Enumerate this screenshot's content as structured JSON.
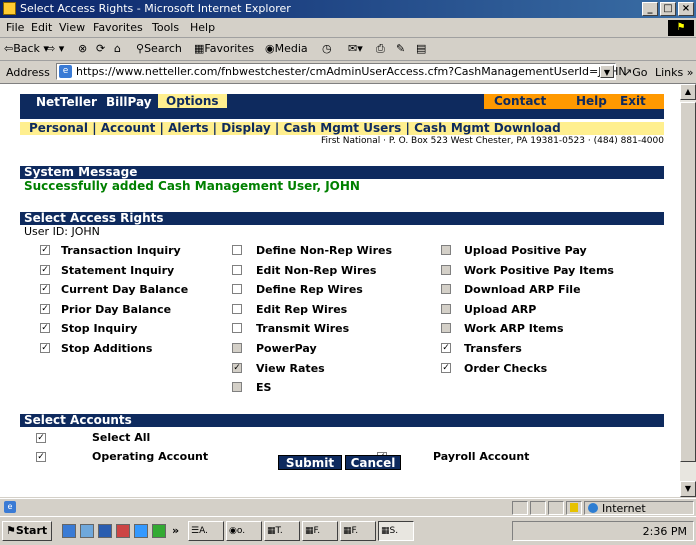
{
  "window": {
    "title": "Select Access Rights - Microsoft Internet Explorer",
    "btn_min": "_",
    "btn_max": "□",
    "btn_close": "×"
  },
  "menu": [
    "File",
    "Edit",
    "View",
    "Favorites",
    "Tools",
    "Help"
  ],
  "toolbar": {
    "back": "⇦Back ▾",
    "forward": "⇨ ▾",
    "stop": "⊗",
    "refresh": "⟳",
    "home": "⌂",
    "search": "Search",
    "favorites": "Favorites",
    "media": "Media",
    "history": "◷",
    "mail": "✉▾",
    "print": "⎙",
    "edit": "✎",
    "discuss": "▤"
  },
  "address": {
    "label": "Address",
    "url": "https://www.netteller.com/fnbwestchester/cmAdminUserAccess.cfm?CashManagementUserId=JOHN",
    "go": "↗Go",
    "links": "Links »"
  },
  "nav": {
    "tabs": [
      "NetTeller",
      "BillPay",
      "Options"
    ],
    "active_tab": "Options",
    "contact": "Contact",
    "help": "Help",
    "exit": "Exit",
    "subnav": [
      "Personal",
      "Account",
      "Alerts",
      "Display",
      "Cash Mgmt Users",
      "Cash Mgmt Download"
    ],
    "separator": "|",
    "bank_address": "First National · P. O. Box 523 West Chester, PA 19381-0523 · (484) 881-4000"
  },
  "system_message": {
    "heading": "System Message",
    "text": "Successfully added Cash Management User, JOHN"
  },
  "access_rights": {
    "heading": "Select Access Rights",
    "user_id": "User ID: JOHN",
    "col1": [
      {
        "label": "Transaction Inquiry",
        "checked": true,
        "disabled": false
      },
      {
        "label": "Statement Inquiry",
        "checked": true,
        "disabled": false
      },
      {
        "label": "Current Day Balance",
        "checked": true,
        "disabled": false
      },
      {
        "label": "Prior Day Balance",
        "checked": true,
        "disabled": false
      },
      {
        "label": "Stop Inquiry",
        "checked": true,
        "disabled": false
      },
      {
        "label": "Stop Additions",
        "checked": true,
        "disabled": false
      }
    ],
    "col2": [
      {
        "label": "Define Non-Rep Wires",
        "checked": false,
        "disabled": false
      },
      {
        "label": "Edit Non-Rep Wires",
        "checked": false,
        "disabled": false
      },
      {
        "label": "Define Rep Wires",
        "checked": false,
        "disabled": false
      },
      {
        "label": "Edit Rep Wires",
        "checked": false,
        "disabled": false
      },
      {
        "label": "Transmit Wires",
        "checked": false,
        "disabled": false
      },
      {
        "label": "PowerPay",
        "checked": false,
        "disabled": true
      },
      {
        "label": "View Rates",
        "checked": true,
        "disabled": true
      },
      {
        "label": "ES",
        "checked": false,
        "disabled": true
      }
    ],
    "col3": [
      {
        "label": "Upload Positive Pay",
        "checked": false,
        "disabled": true
      },
      {
        "label": "Work Positive Pay Items",
        "checked": false,
        "disabled": true
      },
      {
        "label": "Download ARP File",
        "checked": false,
        "disabled": true
      },
      {
        "label": "Upload ARP",
        "checked": false,
        "disabled": true
      },
      {
        "label": "Work ARP Items",
        "checked": false,
        "disabled": true
      },
      {
        "label": "Transfers",
        "checked": true,
        "disabled": false
      },
      {
        "label": "Order Checks",
        "checked": true,
        "disabled": false
      }
    ]
  },
  "accounts": {
    "heading": "Select Accounts",
    "select_all": {
      "label": "Select All",
      "checked": true
    },
    "items": [
      {
        "label": "Operating Account",
        "checked": true
      },
      {
        "label": "Payroll Account",
        "checked": true
      }
    ]
  },
  "buttons": {
    "submit": "Submit",
    "cancel": "Cancel"
  },
  "status": {
    "zone": "Internet"
  },
  "taskbar": {
    "start": "Start",
    "more": "»",
    "tasks": [
      "☰A.",
      "◉o.",
      "▦T.",
      "▦F.",
      "▦F.",
      "▦S."
    ],
    "clock": "2:36 PM"
  },
  "colors": {
    "navy": "#0e2a5e",
    "yellow": "#ffef8f",
    "orange": "#ff9900",
    "green": "#008000",
    "title_start": "#0a246a",
    "title_end": "#3a6ea5"
  },
  "icons": [
    "ie-logo-icon",
    "windows-flag-icon",
    "back-arrow-icon",
    "forward-arrow-icon",
    "stop-icon",
    "refresh-icon",
    "home-icon",
    "search-icon",
    "favorites-icon",
    "media-icon",
    "history-icon",
    "mail-icon",
    "print-icon",
    "edit-icon",
    "discuss-icon",
    "ie-page-icon",
    "lock-icon",
    "globe-icon"
  ]
}
